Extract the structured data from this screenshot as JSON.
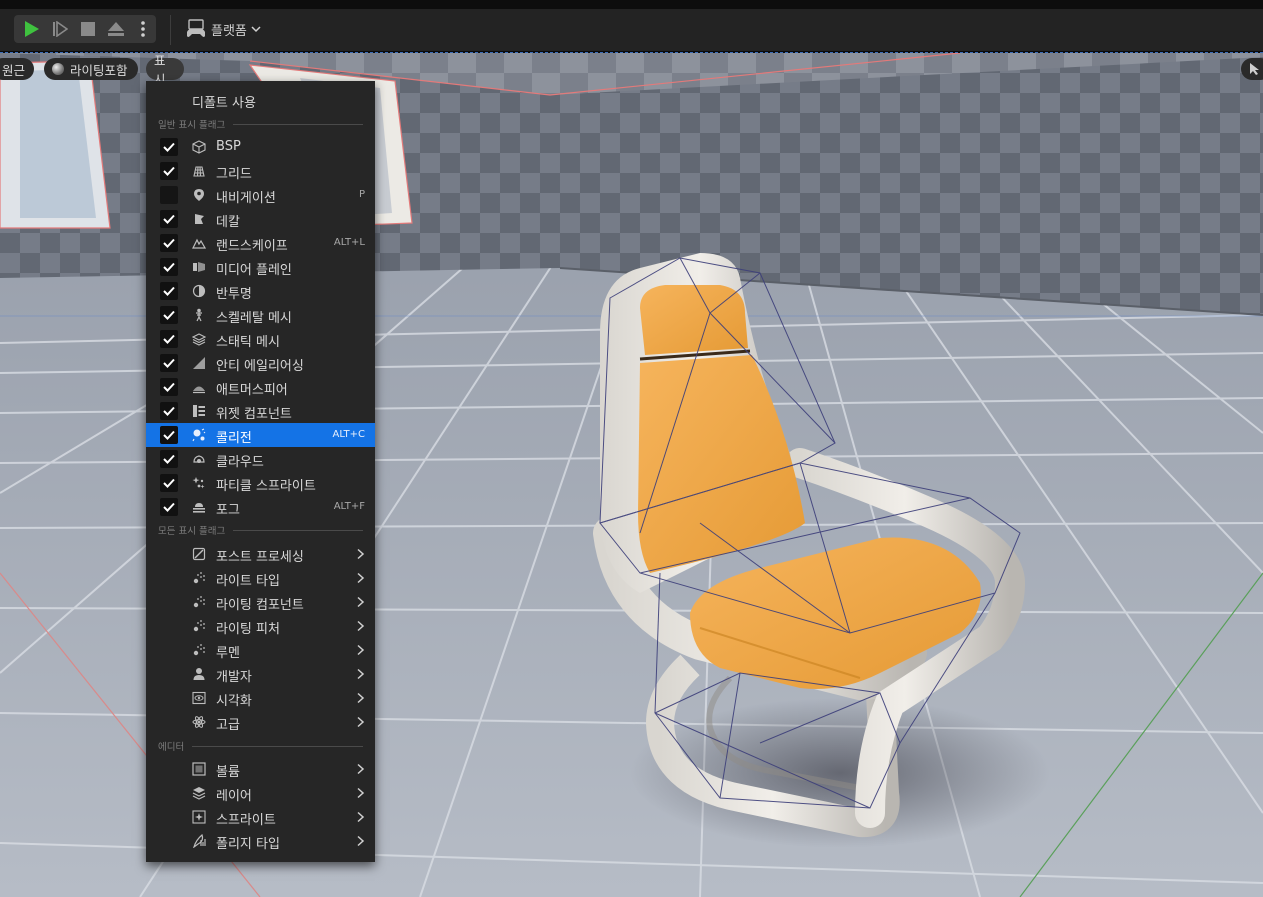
{
  "toolbar": {
    "platform_label": "플랫폼"
  },
  "viewport_bar": {
    "perspective_label": "원근",
    "lighting_label": "라이팅포함",
    "show_label": "표시"
  },
  "menu": {
    "default_label": "디폴트 사용",
    "sections": {
      "general": "일반 표시 플래그",
      "all": "모든 표시 플래그",
      "editor": "에디터"
    },
    "general_items": [
      {
        "label": "BSP",
        "checked": true,
        "shortcut": "",
        "icon": "cube-icon"
      },
      {
        "label": "그리드",
        "checked": true,
        "shortcut": "",
        "icon": "grid-icon"
      },
      {
        "label": "내비게이션",
        "checked": false,
        "shortcut": "P",
        "icon": "map-pin-icon"
      },
      {
        "label": "데칼",
        "checked": true,
        "shortcut": "",
        "icon": "decal-icon"
      },
      {
        "label": "랜드스케이프",
        "checked": true,
        "shortcut": "ALT+L",
        "icon": "mountain-icon"
      },
      {
        "label": "미디어 플레인",
        "checked": true,
        "shortcut": "",
        "icon": "media-plane-icon"
      },
      {
        "label": "반투명",
        "checked": true,
        "shortcut": "",
        "icon": "translucent-icon"
      },
      {
        "label": "스켈레탈 메시",
        "checked": true,
        "shortcut": "",
        "icon": "skeleton-icon"
      },
      {
        "label": "스태틱 메시",
        "checked": true,
        "shortcut": "",
        "icon": "static-mesh-icon"
      },
      {
        "label": "안티 에일리어싱",
        "checked": true,
        "shortcut": "",
        "icon": "antialiasing-icon"
      },
      {
        "label": "애트머스피어",
        "checked": true,
        "shortcut": "",
        "icon": "atmosphere-icon"
      },
      {
        "label": "위젯 컴포넌트",
        "checked": true,
        "shortcut": "",
        "icon": "widget-icon"
      },
      {
        "label": "콜리전",
        "checked": true,
        "shortcut": "ALT+C",
        "icon": "collision-icon",
        "highlighted": true
      },
      {
        "label": "클라우드",
        "checked": true,
        "shortcut": "",
        "icon": "cloud-icon"
      },
      {
        "label": "파티클 스프라이트",
        "checked": true,
        "shortcut": "",
        "icon": "particle-icon"
      },
      {
        "label": "포그",
        "checked": true,
        "shortcut": "ALT+F",
        "icon": "fog-icon"
      }
    ],
    "all_items": [
      {
        "label": "포스트 프로세싱",
        "icon": "post-process-icon"
      },
      {
        "label": "라이트 타입",
        "icon": "light-type-icon"
      },
      {
        "label": "라이팅 컴포넌트",
        "icon": "lighting-component-icon"
      },
      {
        "label": "라이팅 피처",
        "icon": "lighting-feature-icon"
      },
      {
        "label": "루멘",
        "icon": "lumen-icon"
      },
      {
        "label": "개발자",
        "icon": "developer-icon"
      },
      {
        "label": "시각화",
        "icon": "visualize-icon"
      },
      {
        "label": "고급",
        "icon": "advanced-icon"
      }
    ],
    "editor_items": [
      {
        "label": "볼륨",
        "icon": "volume-icon"
      },
      {
        "label": "레이어",
        "icon": "layers-icon"
      },
      {
        "label": "스프라이트",
        "icon": "sprite-icon"
      },
      {
        "label": "폴리지 타입",
        "icon": "foliage-icon"
      }
    ]
  }
}
